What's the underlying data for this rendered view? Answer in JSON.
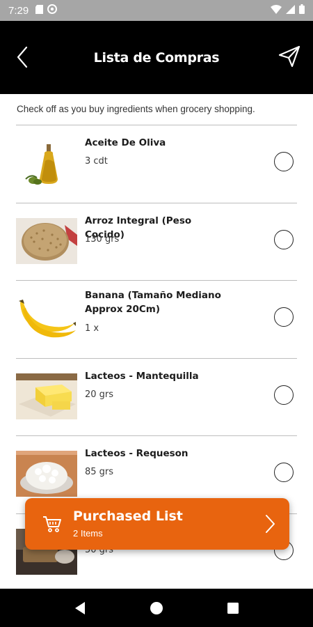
{
  "status_bar": {
    "time": "7:29",
    "icons": [
      "sd-card-icon",
      "at-sign-icon",
      "wifi-icon",
      "signal-icon",
      "battery-icon"
    ]
  },
  "app_bar": {
    "title": "Lista de Compras",
    "back_icon": "chevron-left-icon",
    "send_icon": "paper-plane-icon"
  },
  "subtitle": "Check off as you buy ingredients when grocery shopping.",
  "items": [
    {
      "name": "Aceite De Oliva",
      "quantity": "3 cdt",
      "image": "olive-oil-bottle",
      "checked": false
    },
    {
      "name": "Arroz Integral (Peso Cocido)",
      "quantity": "130 grs",
      "image": "brown-rice",
      "checked": false
    },
    {
      "name": "Banana (Tamaño Mediano Approx 20Cm)",
      "quantity": "1 x",
      "image": "bananas",
      "checked": false
    },
    {
      "name": "Lacteos - Mantequilla",
      "quantity": "20 grs",
      "image": "butter",
      "checked": false
    },
    {
      "name": "Lacteos - Requeson",
      "quantity": "85 grs",
      "image": "cottage-cheese",
      "checked": false
    },
    {
      "name": "",
      "quantity": "50 grs",
      "image": "cutting-board",
      "checked": false
    }
  ],
  "purchased": {
    "title": "Purchased List",
    "count_label": "2 Items",
    "icon": "shopping-cart-icon",
    "accent": "#e8640f"
  },
  "nav_bar": {
    "buttons": [
      "back-triangle-icon",
      "home-circle-icon",
      "recents-square-icon"
    ]
  },
  "colors": {
    "app_bar": "#000000",
    "status_bar": "#a6a6a6",
    "divider": "#bdbdbd"
  }
}
